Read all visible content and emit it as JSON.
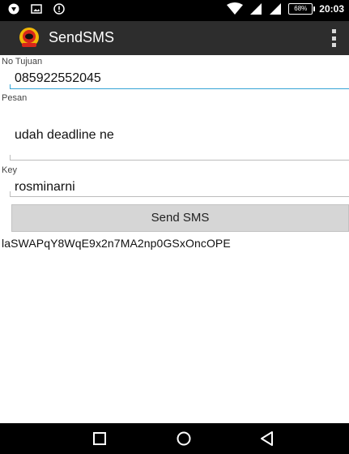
{
  "status_bar": {
    "time": "20:03",
    "battery": "68%",
    "icons": [
      "signal-app-icon",
      "image-icon",
      "alert-icon",
      "wifi-icon",
      "cell-signal-icon",
      "cell-signal-icon",
      "battery-icon"
    ]
  },
  "app": {
    "title": "SendSMS",
    "accent_color": "#35a4d6",
    "action_bar_color": "#2d2d2d"
  },
  "form": {
    "recipient": {
      "label": "No Tujuan",
      "value": "085922552045"
    },
    "message": {
      "label": "Pesan",
      "value": "udah deadline ne"
    },
    "key": {
      "label": "Key",
      "value": "rosminarni"
    },
    "send_label": "Send SMS"
  },
  "output": {
    "encrypted_text": "laSWAPqY8WqE9x2n7MA2np0GSxOncOPE"
  },
  "nav_bar": {
    "buttons": [
      "recents-icon",
      "home-icon",
      "back-icon"
    ]
  }
}
